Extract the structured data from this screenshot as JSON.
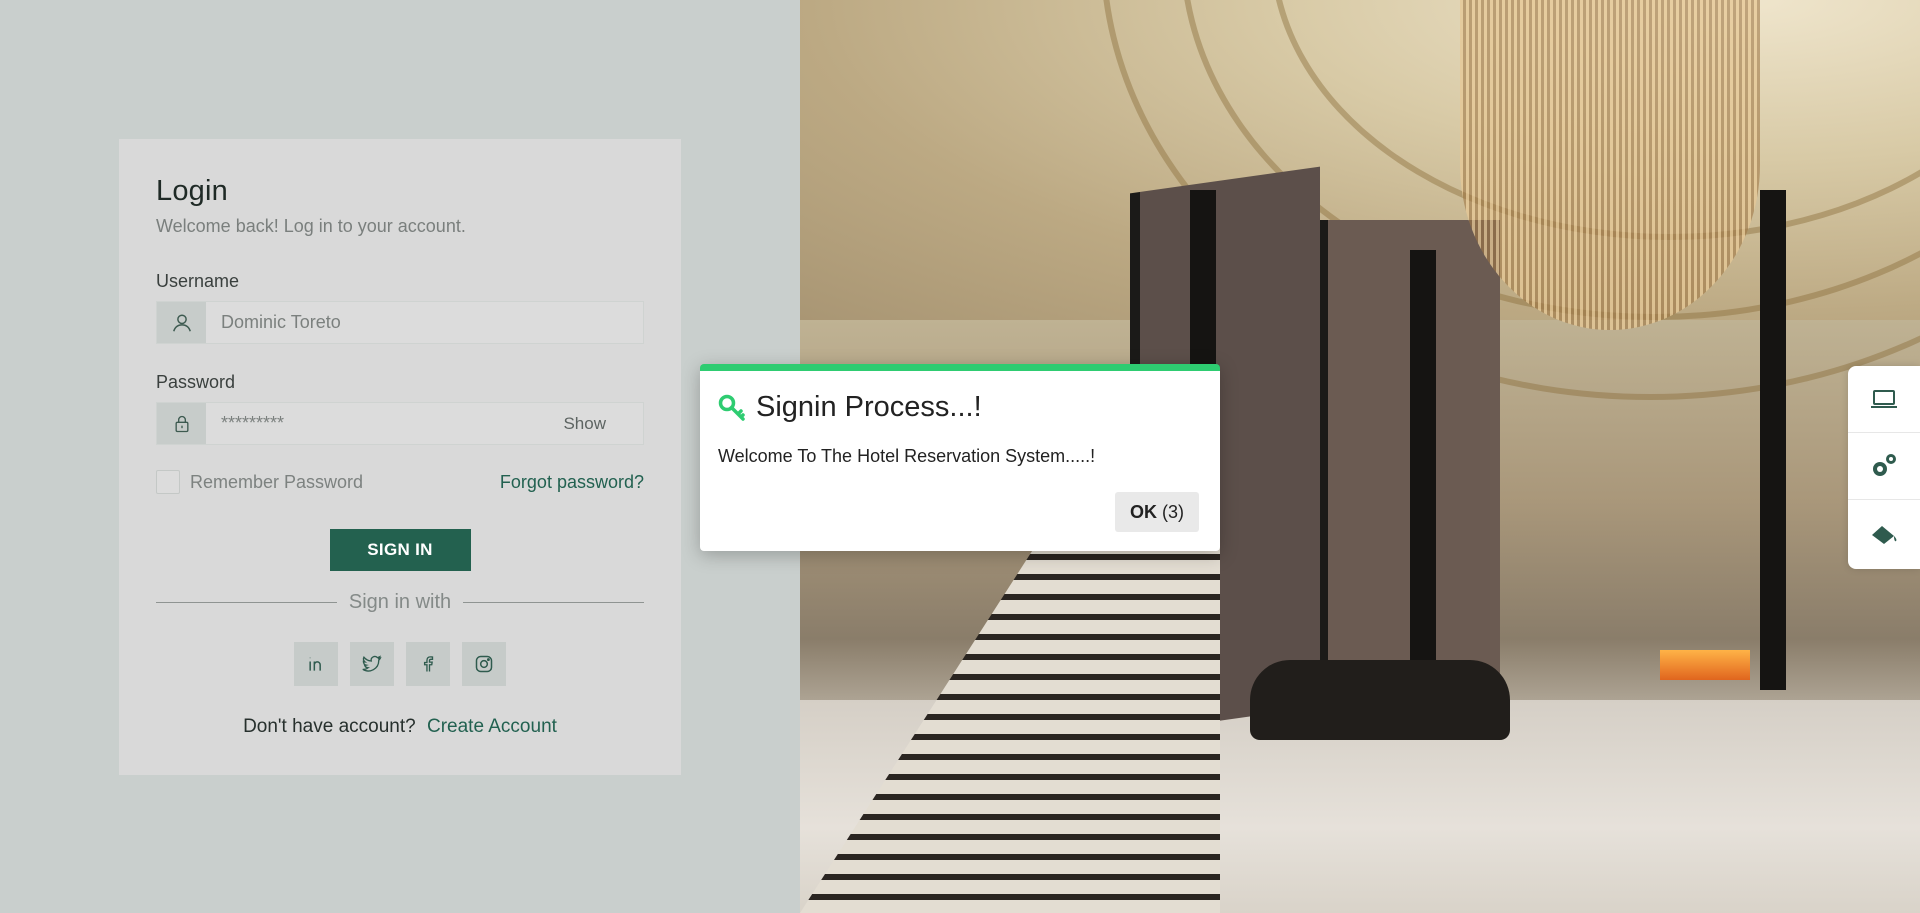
{
  "login": {
    "title": "Login",
    "subtitle": "Welcome back! Log in to your account.",
    "username_label": "Username",
    "username_value": "Dominic Toreto",
    "password_label": "Password",
    "password_value": "*********",
    "show_label": "Show",
    "remember_label": "Remember Password",
    "forgot_label": "Forgot password?",
    "signin_label": "SIGN IN",
    "signin_with": "Sign in with",
    "no_account": "Don't have account?",
    "create_account": "Create Account",
    "socials": [
      "linkedin-icon",
      "twitter-icon",
      "facebook-icon",
      "instagram-icon"
    ]
  },
  "modal": {
    "title": "Signin Process...!",
    "message": "Welcome To The Hotel Reservation System.....!",
    "ok_label": "OK",
    "ok_countdown": "(3)",
    "accent": "#2ecc71"
  },
  "side_tools": [
    "laptop-icon",
    "gears-icon",
    "paint-bucket-icon"
  ],
  "colors": {
    "brand": "#23614f",
    "card": "#d9d9d9",
    "page_bg": "#c9cfcd"
  }
}
